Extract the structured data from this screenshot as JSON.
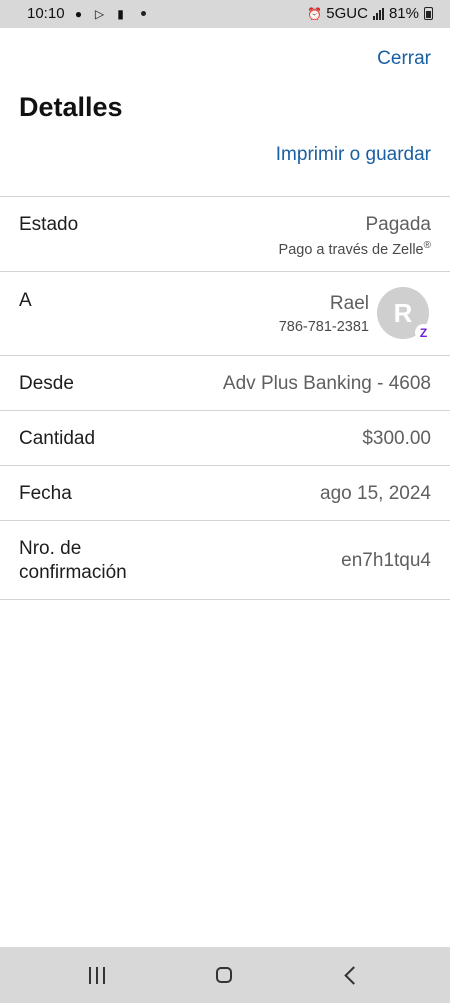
{
  "status_bar": {
    "time": "10:10",
    "network": "5GUC",
    "battery": "81%",
    "icons": [
      "chat-bubble-icon",
      "play-store-icon",
      "youtube-icon",
      "alarm-icon",
      "signal-icon",
      "battery-icon"
    ]
  },
  "header": {
    "close_label": "Cerrar",
    "title": "Detalles",
    "print_label": "Imprimir o guardar"
  },
  "details": {
    "status": {
      "label": "Estado",
      "value": "Pagada",
      "sub": "Pago a través de Zelle",
      "sub_mark": "®"
    },
    "recipient": {
      "label": "A",
      "name": "Rael",
      "phone": "786-781-2381",
      "avatar_initial": "R",
      "badge": "Z"
    },
    "from": {
      "label": "Desde",
      "value": "Adv Plus Banking - 4608"
    },
    "amount": {
      "label": "Cantidad",
      "value": "$300.00"
    },
    "date": {
      "label": "Fecha",
      "value": "ago 15, 2024"
    },
    "confirmation": {
      "label_line1": "Nro. de",
      "label_line2": "confirmación",
      "value": "en7h1tqu4"
    }
  },
  "colors": {
    "link": "#1a5fa3",
    "zelle": "#6d1ed4",
    "divider": "#d3d3d3",
    "system_bar": "#d8d8d8"
  },
  "nav": {
    "icons": [
      "recent-apps-icon",
      "home-icon",
      "back-icon"
    ]
  }
}
